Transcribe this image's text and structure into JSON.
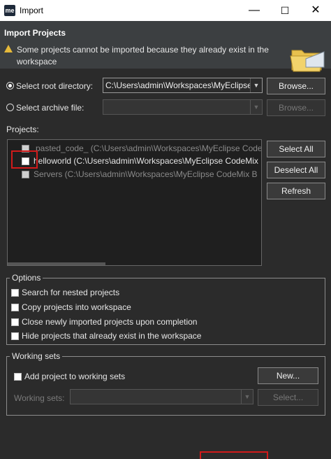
{
  "window": {
    "app_icon_text": "me",
    "title": "Import",
    "minimize": "—",
    "maximize": "☐",
    "close": "✕"
  },
  "banner": {
    "title": "Import Projects",
    "warning": "Some projects cannot be imported because they already exist in the workspace",
    "warning_icon": "warning-icon",
    "art_icon": "folder-icon"
  },
  "source": {
    "root_label": "Select root directory:",
    "root_value": "C:\\Users\\admin\\Workspaces\\MyEclipse",
    "root_selected": true,
    "archive_label": "Select archive file:",
    "archive_value": "",
    "browse_label": "Browse..."
  },
  "projects": {
    "label": "Projects:",
    "items": [
      {
        "text": "pasted_code_ (C:\\Users\\admin\\Workspaces\\MyEclipse CodeMix B",
        "enabled": false,
        "checked": false
      },
      {
        "text": "helloworld (C:\\Users\\admin\\Workspaces\\MyEclipse CodeMix",
        "enabled": true,
        "checked": false
      },
      {
        "text": "Servers (C:\\Users\\admin\\Workspaces\\MyEclipse CodeMix B",
        "enabled": false,
        "checked": false
      }
    ],
    "select_all": "Select All",
    "deselect_all": "Deselect All",
    "refresh": "Refresh"
  },
  "options": {
    "title": "Options",
    "items": [
      {
        "label": "Search for nested projects",
        "checked": false
      },
      {
        "label": "Copy projects into workspace",
        "checked": false
      },
      {
        "label": "Close newly imported projects upon completion",
        "checked": false
      },
      {
        "label": "Hide projects that already exist in the workspace",
        "checked": false
      }
    ]
  },
  "working_sets": {
    "title": "Working sets",
    "add_label": "Add project to working sets",
    "new_button": "New...",
    "sets_label": "Working sets:",
    "sets_value": "",
    "select_button": "Select..."
  },
  "colors": {
    "highlight": "#d11b1b",
    "background": "#2b2b2b"
  }
}
